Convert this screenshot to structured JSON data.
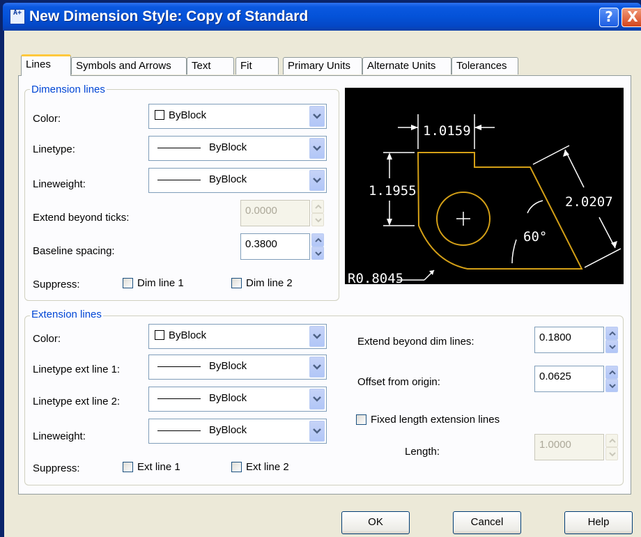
{
  "window": {
    "title": "New Dimension Style: Copy of Standard",
    "help_glyph": "?",
    "close_glyph": "X",
    "app_icon_text": "A+"
  },
  "tabs": [
    {
      "label": "Lines",
      "active": true
    },
    {
      "label": "Symbols and Arrows"
    },
    {
      "label": "Text"
    },
    {
      "label": "Fit"
    },
    {
      "label": "Primary Units"
    },
    {
      "label": "Alternate Units"
    },
    {
      "label": "Tolerances"
    }
  ],
  "dimension_lines": {
    "legend": "Dimension lines",
    "color_label": "Color:",
    "color_value": "ByBlock",
    "linetype_label": "Linetype:",
    "linetype_value": "ByBlock",
    "lineweight_label": "Lineweight:",
    "lineweight_value": "ByBlock",
    "extend_ticks_label": "Extend beyond ticks:",
    "extend_ticks_value": "0.0000",
    "baseline_label": "Baseline spacing:",
    "baseline_value": "0.3800",
    "suppress_label": "Suppress:",
    "dim_line1_label": "Dim line 1",
    "dim_line1_checked": false,
    "dim_line2_label": "Dim line 2",
    "dim_line2_checked": false
  },
  "extension_lines": {
    "legend": "Extension lines",
    "color_label": "Color:",
    "color_value": "ByBlock",
    "linetype1_label": "Linetype ext line 1:",
    "linetype1_value": "ByBlock",
    "linetype2_label": "Linetype ext line 2:",
    "linetype2_value": "ByBlock",
    "lineweight_label": "Lineweight:",
    "lineweight_value": "ByBlock",
    "suppress_label": "Suppress:",
    "ext_line1_label": "Ext line 1",
    "ext_line1_checked": false,
    "ext_line2_label": "Ext line 2",
    "ext_line2_checked": false,
    "extend_dim_label": "Extend beyond dim lines:",
    "extend_dim_value": "0.1800",
    "offset_label": "Offset from origin:",
    "offset_value": "0.0625",
    "fixed_length_label": "Fixed length extension lines",
    "fixed_length_checked": false,
    "length_label": "Length:",
    "length_value": "1.0000"
  },
  "preview": {
    "dim_top": "1.0159",
    "dim_left": "1.1955",
    "dim_right": "2.0207",
    "angle": "60°",
    "radius": "R0.8045",
    "colors": {
      "background": "#000000",
      "geometry": "#d4a017",
      "dimensions": "#ffffff"
    }
  },
  "buttons": {
    "ok": "OK",
    "cancel": "Cancel",
    "help": "Help"
  }
}
